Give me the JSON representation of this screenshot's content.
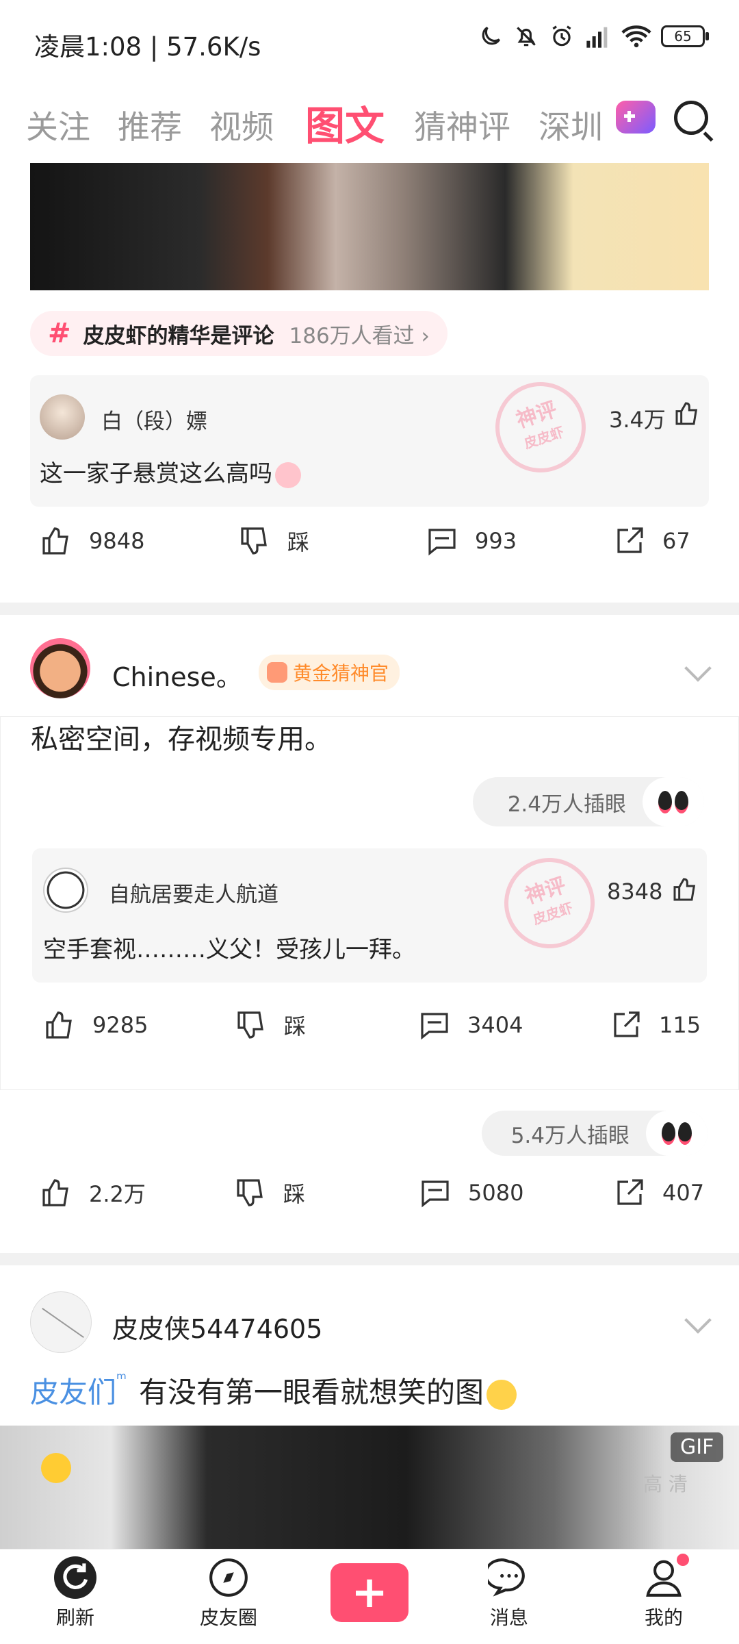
{
  "status": {
    "time_speed": "凌晨1:08 | 57.6K/s",
    "battery": "65"
  },
  "tabs": [
    "关注",
    "推荐",
    "视频",
    "图文",
    "猜神评",
    "深圳"
  ],
  "post1": {
    "topic": {
      "name": "皮皮虾的精华是评论",
      "views": "186万人看过 ›"
    },
    "top_comment": {
      "user": "白（段）嫖",
      "text": "这一家子悬赏这么高吗",
      "likes": "3.4万"
    },
    "stamp": {
      "line1": "神评",
      "line2": "皮皮虾"
    },
    "actions": {
      "like": "9848",
      "dislike": "踩",
      "comment": "993",
      "share": "67"
    }
  },
  "post2": {
    "user": "Chinese。",
    "badge": "黄金猜神官",
    "text": "私密空间，存视频专用。",
    "eye_count": "2.4万人插眼",
    "top_comment": {
      "user": "自航居要走人航道",
      "text": "空手套视………义父！受孩儿一拜。",
      "likes": "8348"
    },
    "stamp": {
      "line1": "神评",
      "line2": "皮皮虾"
    },
    "actions": {
      "like": "9285",
      "dislike": "踩",
      "comment": "3404",
      "share": "115"
    },
    "outer_eye_count": "5.4万人插眼",
    "outer_actions": {
      "like": "2.2万",
      "dislike": "踩",
      "comment": "5080",
      "share": "407"
    }
  },
  "post3": {
    "user": "皮皮侠54474605",
    "tag": "皮友们",
    "text": "有没有第一眼看就想笑的图",
    "gif_label": "GIF",
    "hd_label": "高 清"
  },
  "bottom_nav": [
    "刷新",
    "皮友圈",
    "",
    "消息",
    "我的"
  ]
}
